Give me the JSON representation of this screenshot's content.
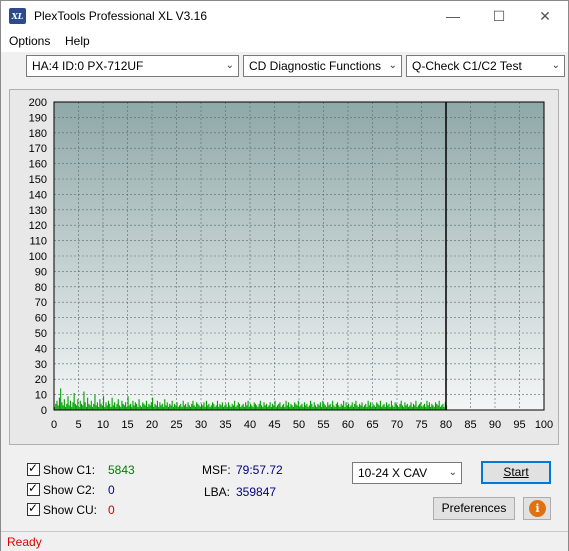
{
  "window": {
    "title": "PlexTools Professional XL V3.16",
    "icon_label": "XL",
    "controls": [
      "minimize-icon",
      "maximize-icon",
      "close-icon"
    ]
  },
  "menu": {
    "options": "Options",
    "help": "Help"
  },
  "toolbar": {
    "drive": "HA:4 ID:0  PX-712UF",
    "function": "CD Diagnostic Functions",
    "test": "Q-Check C1/C2 Test"
  },
  "colors": {
    "c1_value": "#008000",
    "c2_value": "#0000c0",
    "cu_value": "#d00000",
    "msf_value": "#000080",
    "bar": "#00a000",
    "status": "#e00000"
  },
  "chart_data": {
    "type": "bar",
    "x_ticks": [
      0,
      5,
      10,
      15,
      20,
      25,
      30,
      35,
      40,
      45,
      50,
      55,
      60,
      65,
      70,
      75,
      80,
      85,
      90,
      95,
      100
    ],
    "y_ticks": [
      0,
      10,
      20,
      30,
      40,
      50,
      60,
      70,
      80,
      90,
      100,
      110,
      120,
      130,
      140,
      150,
      160,
      170,
      180,
      190,
      200
    ],
    "xlim": [
      0,
      100
    ],
    "ylim": [
      0,
      200
    ],
    "disc_end_x": 80,
    "grid": true,
    "series": [
      {
        "values_x_step": 0.25,
        "values": [
          2,
          4,
          6,
          3,
          8,
          14,
          5,
          3,
          7,
          2,
          4,
          9,
          3,
          6,
          2,
          5,
          11,
          4,
          3,
          7,
          2,
          6,
          4,
          3,
          12,
          5,
          2,
          8,
          4,
          3,
          6,
          2,
          4,
          10,
          3,
          5,
          2,
          7,
          4,
          3,
          9,
          2,
          5,
          3,
          6,
          4,
          2,
          8,
          3,
          5,
          2,
          4,
          7,
          3,
          2,
          6,
          4,
          3,
          5,
          2,
          9,
          3,
          4,
          2,
          6,
          3,
          5,
          4,
          2,
          7,
          3,
          2,
          5,
          4,
          3,
          6,
          2,
          4,
          3,
          5,
          8,
          2,
          4,
          3,
          6,
          2,
          5,
          3,
          4,
          2,
          7,
          3,
          5,
          2,
          4,
          3,
          6,
          2,
          4,
          3,
          5,
          2,
          3,
          4,
          2,
          6,
          3,
          4,
          2,
          5,
          3,
          2,
          4,
          6,
          3,
          2,
          5,
          4,
          3,
          2,
          4,
          3,
          5,
          2,
          6,
          3,
          4,
          2,
          3,
          5,
          4,
          2,
          3,
          6,
          2,
          4,
          3,
          5,
          2,
          3,
          4,
          2,
          5,
          3,
          2,
          4,
          3,
          6,
          2,
          3,
          5,
          4,
          2,
          3,
          4,
          2,
          5,
          3,
          6,
          2,
          4,
          3,
          2,
          5,
          4,
          3,
          2,
          4,
          6,
          3,
          2,
          5,
          3,
          4,
          2,
          3,
          5,
          2,
          4,
          3,
          6,
          2,
          3,
          4,
          5,
          2,
          3,
          4,
          2,
          6,
          3,
          5,
          2,
          4,
          3,
          2,
          5,
          4,
          3,
          6,
          2,
          3,
          4,
          2,
          5,
          3,
          4,
          2,
          3,
          6,
          4,
          2,
          5,
          3,
          2,
          4,
          3,
          5,
          2,
          6,
          4,
          3,
          2,
          5,
          3,
          4,
          2,
          6,
          3,
          2,
          4,
          5,
          3,
          2,
          4,
          3,
          6,
          2,
          5,
          3,
          4,
          2,
          3,
          5,
          2,
          4,
          6,
          3,
          2,
          4,
          3,
          5,
          2,
          3,
          4,
          2,
          6,
          3,
          5,
          2,
          4,
          3,
          2,
          5,
          4,
          3,
          6,
          2,
          3,
          4,
          2,
          5,
          3,
          4,
          2,
          6,
          3,
          2,
          5,
          4,
          3,
          2,
          4,
          6,
          3,
          2,
          5,
          3,
          4,
          2,
          3,
          5,
          2,
          4,
          3,
          6,
          2,
          3,
          4,
          5,
          2,
          3,
          4,
          2,
          6,
          3,
          5,
          2,
          4,
          3,
          2,
          5,
          4,
          3,
          6,
          2,
          3,
          4,
          2,
          5,
          3,
          4,
          2,
          3,
          6,
          4,
          2,
          5,
          3,
          2,
          4,
          3,
          5,
          2
        ]
      }
    ]
  },
  "bottom": {
    "show_c1_label": "Show C1:",
    "show_c2_label": "Show C2:",
    "show_cu_label": "Show CU:",
    "c1_value": "5843",
    "c2_value": "0",
    "cu_value": "0",
    "msf_label": "MSF:",
    "msf_value": "79:57.72",
    "lba_label": "LBA:",
    "lba_value": "359847",
    "speed": "10-24 X CAV",
    "start_button": "Start",
    "preferences_button": "Preferences"
  },
  "status": {
    "text": "Ready"
  }
}
